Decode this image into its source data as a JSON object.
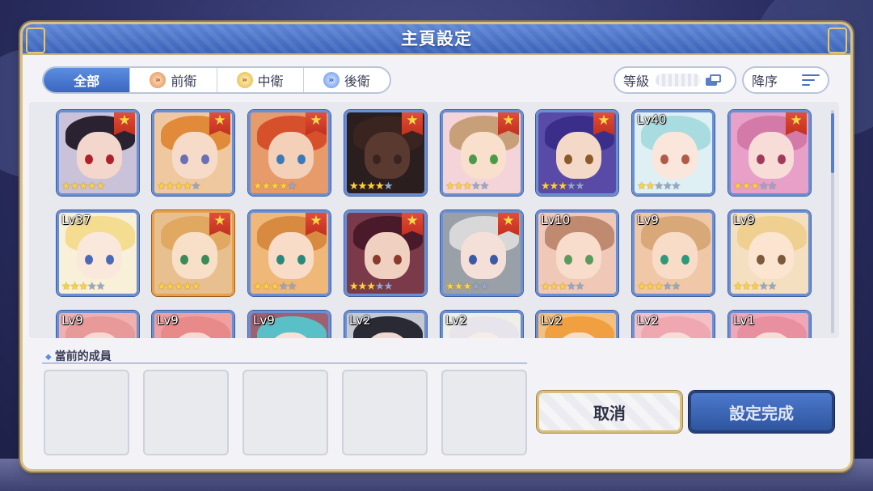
{
  "dialog": {
    "title": "主頁設定",
    "tabs": [
      {
        "label": "全部",
        "icon": null,
        "active": true
      },
      {
        "label": "前衛",
        "icon": "front-position-icon",
        "active": false
      },
      {
        "label": "中衛",
        "icon": "middle-position-icon",
        "active": false
      },
      {
        "label": "後衛",
        "icon": "back-position-icon",
        "active": false
      }
    ],
    "sort_level_label": "等級",
    "sort_order_label": "降序",
    "members_label": "當前的成員",
    "cancel_label": "取消",
    "confirm_label": "設定完成"
  },
  "characters": [
    {
      "lv": "",
      "fav": true,
      "stars": 5,
      "frame": "blue",
      "hair": "#2a2230",
      "skin": "#f3d6cc",
      "eye": "#b0202a",
      "bg": "#c9c2d8"
    },
    {
      "lv": "",
      "fav": true,
      "stars": 4,
      "frame": "blue",
      "hair": "#e08a3a",
      "skin": "#f6dcc8",
      "eye": "#6a6fb8",
      "bg": "#f0c8a0"
    },
    {
      "lv": "",
      "fav": true,
      "stars": 4,
      "frame": "blue",
      "hair": "#d6502c",
      "skin": "#f4d0b8",
      "eye": "#3b7ab8",
      "bg": "#e79a6a"
    },
    {
      "lv": "",
      "fav": true,
      "stars": 4,
      "frame": "blue",
      "hair": "#3a2420",
      "skin": "#5a3a30",
      "eye": "#3a2420",
      "bg": "#2a1e1e"
    },
    {
      "lv": "",
      "fav": true,
      "stars": 3,
      "frame": "blue",
      "hair": "#c7a07a",
      "skin": "#f8e0cc",
      "eye": "#4a9a4a",
      "bg": "#f4d4d8"
    },
    {
      "lv": "",
      "fav": true,
      "stars": 3,
      "frame": "blue",
      "hair": "#3a2e8a",
      "skin": "#f4d8c8",
      "eye": "#8a5a2a",
      "bg": "#5a4aa8"
    },
    {
      "lv": "Lv40",
      "fav": false,
      "stars": 2,
      "frame": "blue",
      "hair": "#a8dce0",
      "skin": "#fbe6dc",
      "eye": "#b05a4a",
      "bg": "#dff0f4"
    },
    {
      "lv": "",
      "fav": true,
      "stars": 3,
      "frame": "blue",
      "hair": "#d47aa8",
      "skin": "#f8dcd8",
      "eye": "#a03a5a",
      "bg": "#e8a0c8"
    },
    {
      "lv": "Lv37",
      "fav": false,
      "stars": 3,
      "frame": "blue",
      "hair": "#f4dc90",
      "skin": "#fbe8dc",
      "eye": "#4a6ab8",
      "bg": "#f8f0d8"
    },
    {
      "lv": "",
      "fav": true,
      "stars": 5,
      "frame": "gold",
      "hair": "#e0a860",
      "skin": "#f8e0c8",
      "eye": "#3a8a5a",
      "bg": "#e8c090"
    },
    {
      "lv": "",
      "fav": true,
      "stars": 3,
      "frame": "blue",
      "hair": "#d88a40",
      "skin": "#f8dcc8",
      "eye": "#2a8a7a",
      "bg": "#f0b878"
    },
    {
      "lv": "",
      "fav": true,
      "stars": 3,
      "frame": "blue",
      "hair": "#4a1a2a",
      "skin": "#f0d0c0",
      "eye": "#8a3a2a",
      "bg": "#7a3a4a"
    },
    {
      "lv": "",
      "fav": true,
      "stars": 3,
      "frame": "blue",
      "hair": "#d8d8d8",
      "skin": "#f4e0d8",
      "eye": "#3a5aa8",
      "bg": "#9aa0a8"
    },
    {
      "lv": "Lv10",
      "fav": false,
      "stars": 3,
      "frame": "blue",
      "hair": "#c08a70",
      "skin": "#f8dccc",
      "eye": "#5a9a5a",
      "bg": "#f0c8b8"
    },
    {
      "lv": "Lv9",
      "fav": false,
      "stars": 3,
      "frame": "blue",
      "hair": "#d8a878",
      "skin": "#f8dcc8",
      "eye": "#2a9a7a",
      "bg": "#f0c8a8"
    },
    {
      "lv": "Lv9",
      "fav": false,
      "stars": 3,
      "frame": "blue",
      "hair": "#f0d090",
      "skin": "#fbe4d0",
      "eye": "#7a5a3a",
      "bg": "#f4e0c0"
    },
    {
      "lv": "Lv9",
      "fav": false,
      "stars": 0,
      "frame": "blue",
      "hair": "#e89a9a",
      "skin": "#f8d8d0",
      "eye": "#a04a4a",
      "bg": "#f0b0b0"
    },
    {
      "lv": "Lv9",
      "fav": false,
      "stars": 0,
      "frame": "blue",
      "hair": "#e88a8a",
      "skin": "#f8d8d0",
      "eye": "#a04a4a",
      "bg": "#f0a0a0"
    },
    {
      "lv": "Lv9",
      "fav": false,
      "stars": 0,
      "frame": "blue",
      "hair": "#5ac0c8",
      "skin": "#f8e0d8",
      "eye": "#2a6a8a",
      "bg": "#a06070"
    },
    {
      "lv": "Lv2",
      "fav": false,
      "stars": 0,
      "frame": "blue",
      "hair": "#2a2a34",
      "skin": "#f0d8d0",
      "eye": "#3a3a4a",
      "bg": "#c8c8d0"
    },
    {
      "lv": "Lv2",
      "fav": false,
      "stars": 0,
      "frame": "blue",
      "hair": "#e8e4ec",
      "skin": "#f8ece8",
      "eye": "#6a8a6a",
      "bg": "#eef0e8"
    },
    {
      "lv": "Lv2",
      "fav": false,
      "stars": 0,
      "frame": "blue",
      "hair": "#f0a040",
      "skin": "#f8dcc8",
      "eye": "#7a4a2a",
      "bg": "#f4c080"
    },
    {
      "lv": "Lv2",
      "fav": false,
      "stars": 0,
      "frame": "blue",
      "hair": "#f0a8b0",
      "skin": "#f8dcd8",
      "eye": "#a04a5a",
      "bg": "#f4c0c8"
    },
    {
      "lv": "Lv1",
      "fav": false,
      "stars": 0,
      "frame": "blue",
      "hair": "#e890a0",
      "skin": "#f8dcd8",
      "eye": "#a04a5a",
      "bg": "#f0a8b8"
    }
  ],
  "member_slots": 5
}
